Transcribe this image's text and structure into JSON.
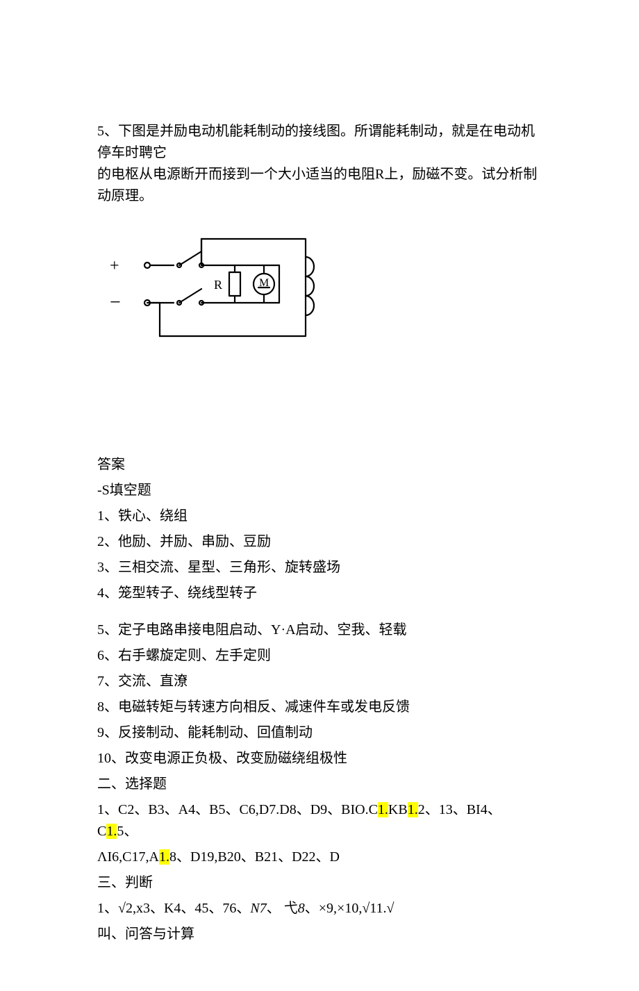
{
  "q5": {
    "line1": "5、下图是并励电动机能耗制动的接线图。所谓能耗制动，就是在电动机停车时聘它",
    "line2": "的电枢从电源断开而接到一个大小适当的电阻R上，励磁不变。试分析制动原理。"
  },
  "diagram": {
    "plus": "+",
    "minus": "−",
    "R": "R",
    "M": "M"
  },
  "answers": {
    "title": "答案",
    "fillTitle": "-S填空题",
    "fill": [
      "1、铁心、绕组",
      "2、他励、并励、串励、豆励",
      "3、三相交流、星型、三角形、旋转盛场",
      "4、笼型转子、绕线型转子",
      "5、定子电路串接电阻启动、Y·A启动、空我、轻载",
      "6、右手螺旋定则、左手定则",
      "7、交流、直潦",
      "8、电磁转矩与转速方向相反、减速件车或发电反馈",
      "9、反接制动、能耗制动、回值制动",
      "10、改变电源正负极、改变励磁绕组极性"
    ],
    "choiceTitle": "二、选择题",
    "choice": {
      "pre1": "1、C2、B3、A4、B5、C6,D7.D8、D9、BIO.C",
      "hl1": "1.",
      "mid1": "KB",
      "hl2": "1.",
      "mid2": "2、13、BI4、C",
      "hl3": "1.",
      "mid3": "5、",
      "line2a": "ΛI6,C17,A",
      "hl4": "1.",
      "line2b": "8、D19,B20、B21、D22、D"
    },
    "tfTitle": "三、判断",
    "tf": {
      "a": "1、√2,x3、K4、45、76、",
      "nz": "N7",
      "b": "、 弋",
      "eight": "8",
      "c": "、×9,×10,√11.√"
    },
    "calcTitle": "叫、问答与计算"
  }
}
